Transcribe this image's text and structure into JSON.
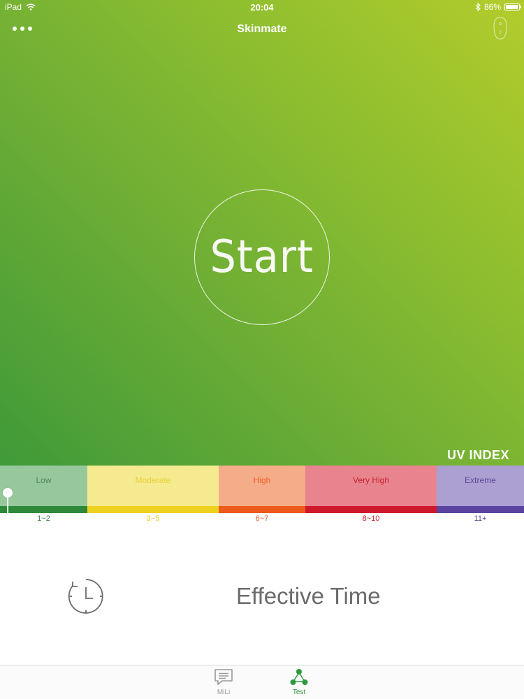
{
  "status_bar": {
    "device": "iPad",
    "time": "20:04",
    "battery": "86%",
    "battery_level": 0.86
  },
  "nav": {
    "title": "Skinmate",
    "more_icon": "more-dots-icon",
    "device_icon": "device-icon"
  },
  "start": {
    "label": "Start"
  },
  "uv": {
    "title": "UV INDEX",
    "levels": [
      {
        "label": "Low",
        "range": "1~2",
        "fill": "#97c89c",
        "strip": "#2e8a3a",
        "text": "#4b8a52",
        "range_text": "#3a8040",
        "width": 125
      },
      {
        "label": "Moderate",
        "range": "3~5",
        "fill": "#f5ea8f",
        "strip": "#ecd21e",
        "text": "#e7d23a",
        "range_text": "#e8cf2a",
        "width": 188
      },
      {
        "label": "High",
        "range": "6~7",
        "fill": "#f4ad88",
        "strip": "#ed5a1c",
        "text": "#ee5e2a",
        "range_text": "#ee5e2a",
        "width": 124
      },
      {
        "label": "Very High",
        "range": "8~10",
        "fill": "#e8848d",
        "strip": "#d0182c",
        "text": "#c8202f",
        "range_text": "#c8202f",
        "width": 188
      },
      {
        "label": "Extreme",
        "range": "11+",
        "fill": "#ac9fd2",
        "strip": "#5b44a0",
        "text": "#5c4a95",
        "range_text": "#5c4a95",
        "width": 125
      }
    ],
    "current_level": 0
  },
  "effective_time": {
    "label": "Effective Time",
    "icon": "clock-timer-icon"
  },
  "tabs": [
    {
      "label": "MiLi",
      "icon": "chat-bubble-icon",
      "active": false
    },
    {
      "label": "Test",
      "icon": "share-nodes-icon",
      "active": true
    }
  ],
  "colors": {
    "accent": "#2e9a3c",
    "inactive_tab": "#9a9a9a"
  }
}
